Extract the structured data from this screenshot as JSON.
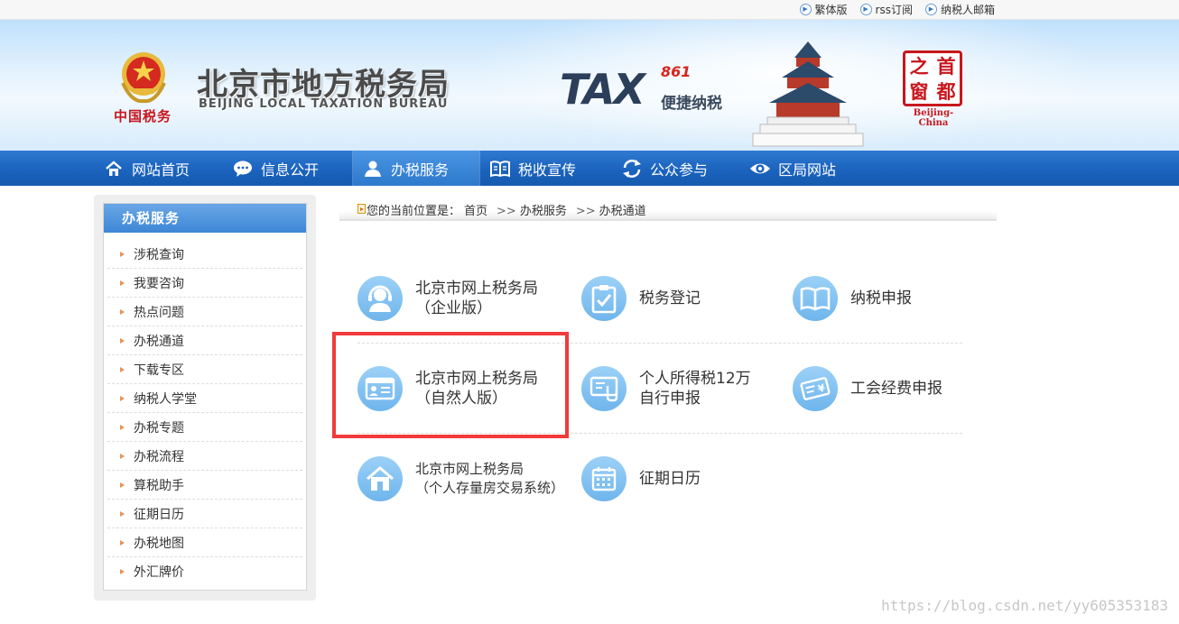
{
  "topbar": {
    "links": [
      {
        "label": "繁体版",
        "icon": "play-circle-icon"
      },
      {
        "label": "rss订阅",
        "icon": "play-circle-icon"
      },
      {
        "label": "纳税人邮箱",
        "icon": "play-circle-icon"
      }
    ]
  },
  "banner": {
    "emblem_text": "中国税务",
    "title_cn": "北京市地方税务局",
    "title_en": "BEIJING LOCAL TAXATION BUREAU",
    "tax_text": "TAX",
    "tax_number": "861",
    "tax_slogan": "便捷纳税",
    "seal_chars": [
      "之",
      "首",
      "窗",
      "都"
    ],
    "seal_caption": "Beijing-China"
  },
  "nav": {
    "items": [
      {
        "label": "网站首页",
        "icon": "home-icon",
        "active": false
      },
      {
        "label": "信息公开",
        "icon": "chat-bubble-icon",
        "active": false
      },
      {
        "label": "办税服务",
        "icon": "user-icon",
        "active": true
      },
      {
        "label": "税收宣传",
        "icon": "book-icon",
        "active": false
      },
      {
        "label": "公众参与",
        "icon": "refresh-arrows-icon",
        "active": false
      },
      {
        "label": "区局网站",
        "icon": "eye-icon",
        "active": false
      }
    ]
  },
  "sidebar": {
    "title": "办税服务",
    "items": [
      "涉税查询",
      "我要咨询",
      "热点问题",
      "办税通道",
      "下载专区",
      "纳税人学堂",
      "办税专题",
      "办税流程",
      "算税助手",
      "征期日历",
      "办税地图",
      "外汇牌价"
    ]
  },
  "breadcrumb": {
    "prefix": "您的当前位置是：",
    "items": [
      "首页",
      "办税服务",
      "办税通道"
    ],
    "separator": ">>"
  },
  "services": {
    "row1": [
      {
        "line1": "北京市网上税务局",
        "line2": "（企业版）",
        "icon": "customer-service-icon"
      },
      {
        "line1": "税务登记",
        "line2": "",
        "icon": "clipboard-check-icon"
      },
      {
        "line1": "纳税申报",
        "line2": "",
        "icon": "open-book-icon"
      }
    ],
    "row2": [
      {
        "line1": "北京市网上税务局",
        "line2": "（自然人版）",
        "icon": "id-card-icon"
      },
      {
        "line1": "个人所得税12万",
        "line2": "自行申报",
        "icon": "touchscreen-icon"
      },
      {
        "line1": "工会经费申报",
        "line2": "",
        "icon": "yen-card-icon"
      }
    ],
    "row3": [
      {
        "line1": "北京市网上税务局",
        "line2": "（个人存量房交易系统）",
        "icon": "house-icon"
      },
      {
        "line1": "征期日历",
        "line2": "",
        "icon": "calendar-icon"
      }
    ]
  },
  "watermark": "https://blog.csdn.net/yy605353183",
  "colors": {
    "nav_blue": "#1b63be",
    "highlight_red": "#f23a3a",
    "icon_blue": "#6fb5ec",
    "emblem_red": "#c8161d"
  }
}
